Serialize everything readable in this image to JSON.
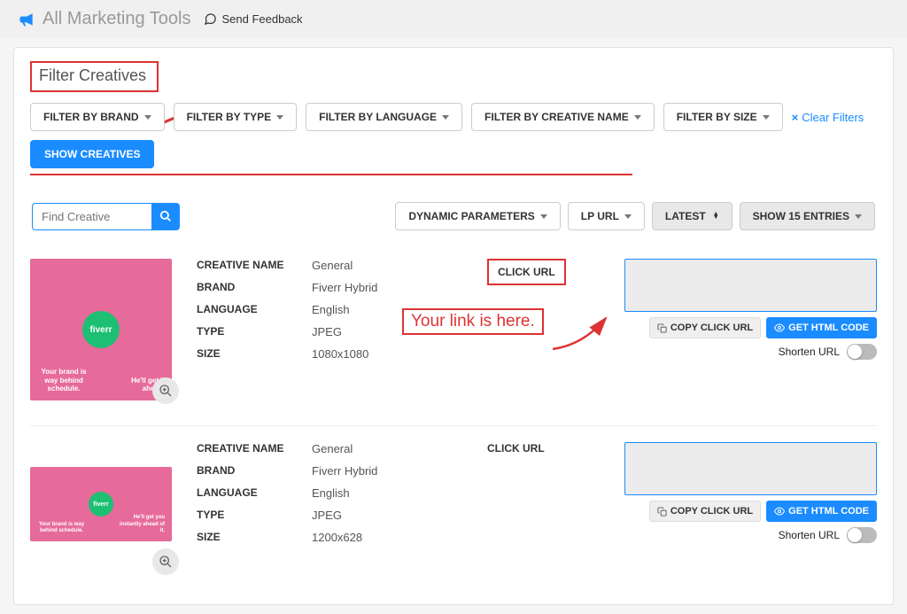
{
  "topbar": {
    "title": "All Marketing Tools",
    "feedback": "Send Feedback"
  },
  "filters": {
    "heading": "Filter Creatives",
    "brand": "FILTER BY BRAND",
    "type": "FILTER BY TYPE",
    "language": "FILTER BY LANGUAGE",
    "creative_name": "FILTER BY CREATIVE NAME",
    "size": "FILTER BY SIZE",
    "clear": "Clear Filters",
    "show": "SHOW CREATIVES"
  },
  "toolbar": {
    "search_placeholder": "Find Creative",
    "dynamic": "DYNAMIC PARAMETERS",
    "lp": "LP URL",
    "latest": "LATEST",
    "show_entries": "SHOW 15 ENTRIES"
  },
  "labels": {
    "creative_name": "CREATIVE NAME",
    "brand": "BRAND",
    "language": "LANGUAGE",
    "type": "TYPE",
    "size": "SIZE",
    "click_url": "CLICK URL",
    "copy": "COPY CLICK URL",
    "get_html": "GET HTML CODE",
    "shorten": "Shorten URL"
  },
  "annotation": "Your link is here.",
  "creatives": [
    {
      "name": "General",
      "brand": "Fiverr Hybrid",
      "language": "English",
      "type": "JPEG",
      "size": "1080x1080",
      "badge": "fiverr",
      "capL": "Your brand is way behind schedule.",
      "capR": "He'll get it ahead."
    },
    {
      "name": "General",
      "brand": "Fiverr Hybrid",
      "language": "English",
      "type": "JPEG",
      "size": "1200x628",
      "badge": "fiverr",
      "capL": "Your brand is way behind schedule.",
      "capR": "He'll get you instantly ahead of it."
    }
  ]
}
